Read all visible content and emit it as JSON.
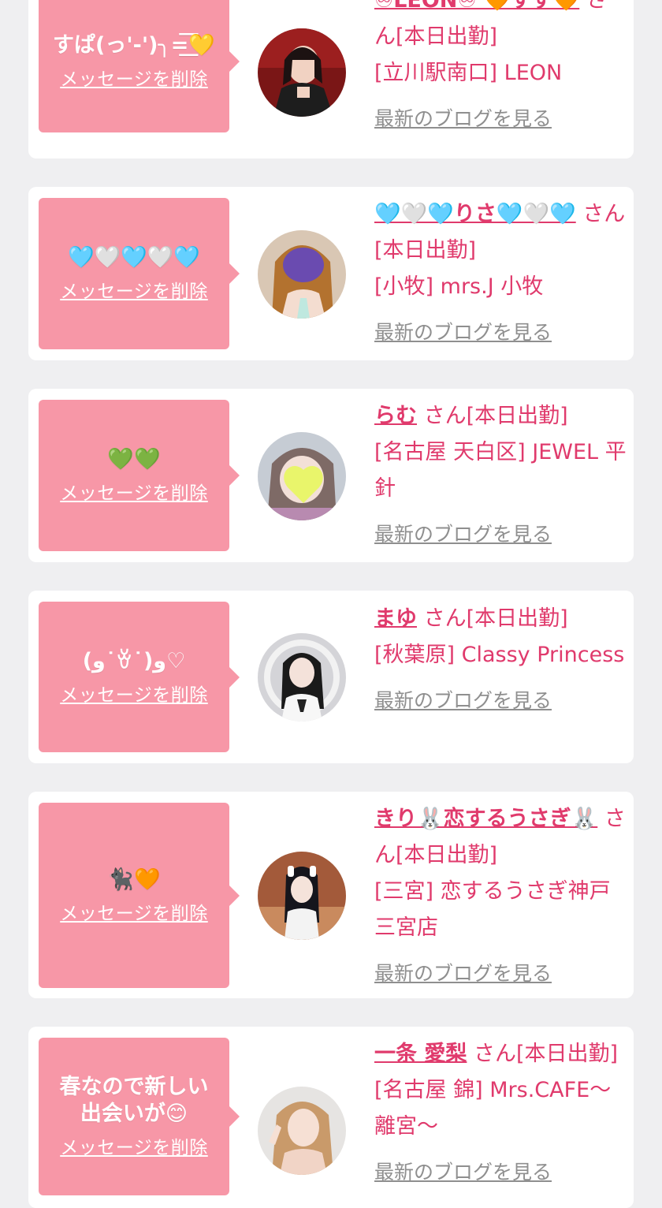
{
  "cards": [
    {
      "message": "すぱ(っ'-')╮=͟͟͞͞💛",
      "delete_label": "メッセージを削除",
      "name": "♾LEON♾ 🧡すず🧡",
      "suffix": "さん[本日出勤]",
      "shop": "[立川駅南口] LEON",
      "blog_label": "最新のブログを見る",
      "avatar_icon": "girl-photo-avatar"
    },
    {
      "message": "🩵🤍🩵🤍🩵",
      "delete_label": "メッセージを削除",
      "name": "🩵🤍🩵りさ🩵🤍🩵",
      "suffix": "さん[本日出勤]",
      "shop": "[小牧] mrs.J 小牧",
      "blog_label": "最新のブログを見る",
      "avatar_icon": "girl-photo-avatar"
    },
    {
      "message": "💚💚",
      "delete_label": "メッセージを削除",
      "name": "らむ",
      "suffix": "さん[本日出勤]",
      "shop": "[名古屋 天白区] JEWEL 平針",
      "blog_label": "最新のブログを見る",
      "avatar_icon": "girl-photo-avatar"
    },
    {
      "message": "(و˙ꈊ˙)و♡",
      "delete_label": "メッセージを削除",
      "name": "まゆ",
      "suffix": "さん[本日出勤]",
      "shop": "[秋葉原] Classy Princess",
      "blog_label": "最新のブログを見る",
      "avatar_icon": "girl-photo-avatar"
    },
    {
      "message": "🐈‍⬛🧡",
      "delete_label": "メッセージを削除",
      "name": "きり🐰恋するうさぎ🐰",
      "suffix": "さん[本日出勤]",
      "shop": "[三宮] 恋するうさぎ神戸三宮店",
      "blog_label": "最新のブログを見る",
      "avatar_icon": "girl-photo-avatar"
    },
    {
      "message": "春なので新しい出会いが😊",
      "delete_label": "メッセージを削除",
      "name": "一条 愛梨",
      "suffix": "さん[本日出勤]",
      "shop": "[名古屋 錦] Mrs.CAFE〜離宮〜",
      "blog_label": "最新のブログを見る",
      "avatar_icon": "girl-photo-avatar"
    }
  ],
  "colors": {
    "page_bg": "#efeff1",
    "bubble": "#f797a7",
    "accent": "#e03a6c",
    "link_gray": "#8f8f8f"
  }
}
